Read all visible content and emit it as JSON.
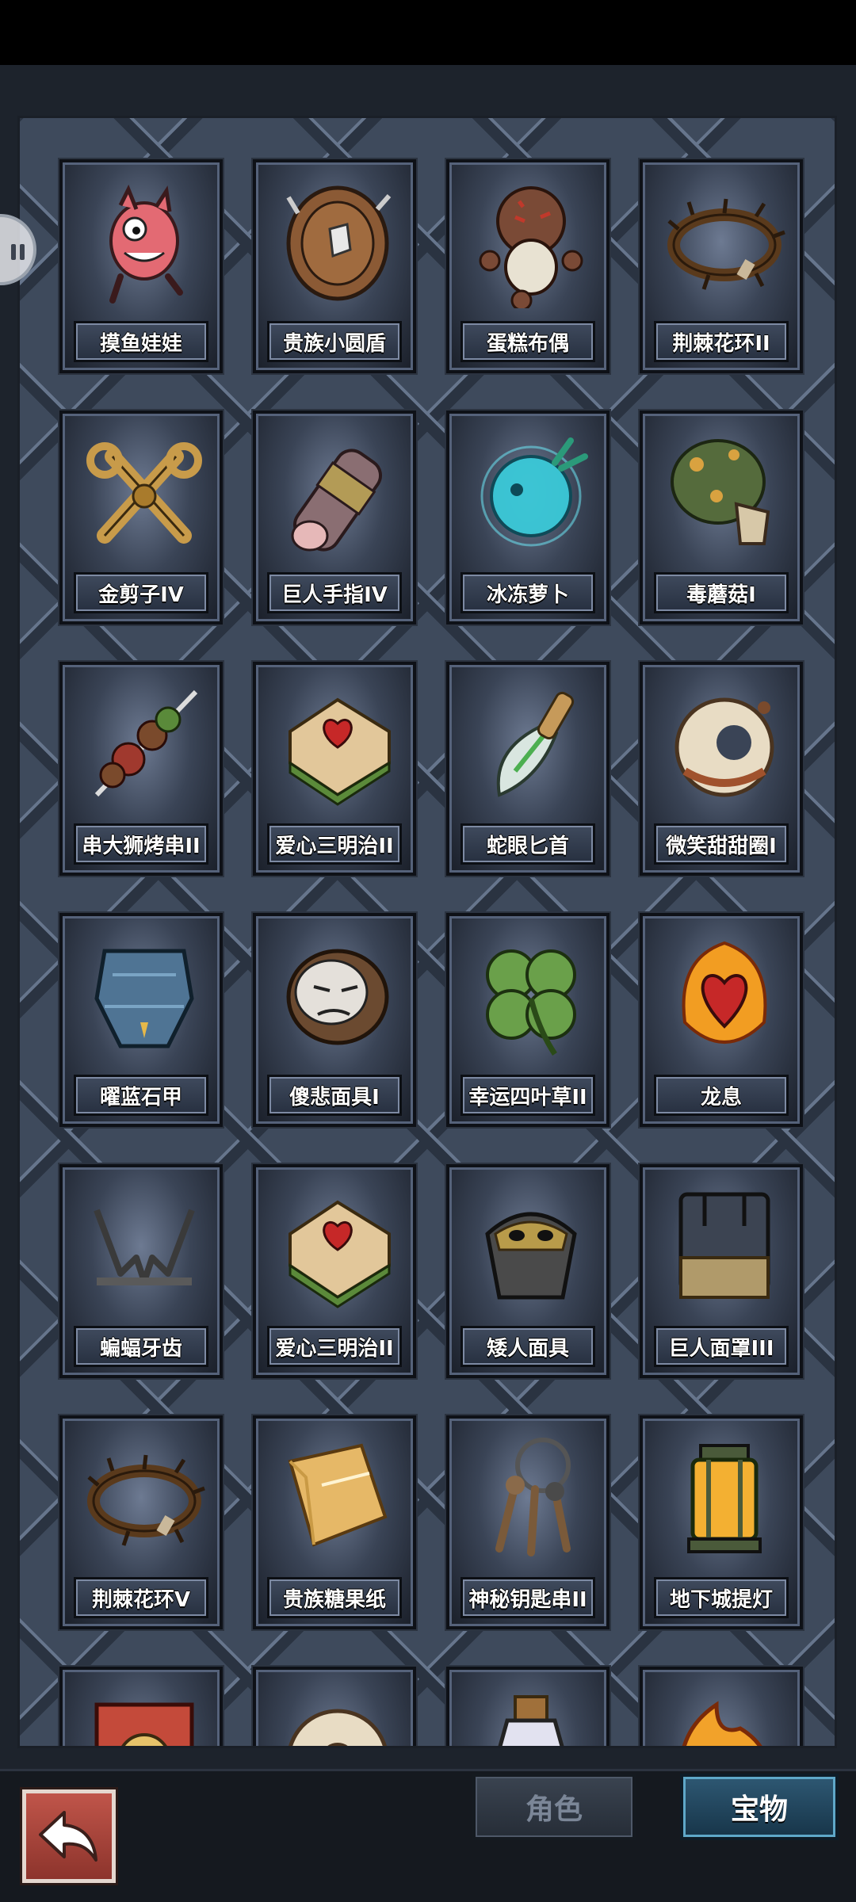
{
  "inventory": {
    "items": [
      {
        "name": "摸鱼娃娃",
        "icon": "pink-fish-doll-icon"
      },
      {
        "name": "贵族小圆盾",
        "icon": "wooden-round-shield-icon"
      },
      {
        "name": "蛋糕布偶",
        "icon": "cake-voodoo-doll-icon"
      },
      {
        "name": "荆棘花环II",
        "icon": "thorn-wreath-icon"
      },
      {
        "name": "金剪子IV",
        "icon": "golden-scissors-icon"
      },
      {
        "name": "巨人手指IV",
        "icon": "giant-finger-icon"
      },
      {
        "name": "冰冻萝卜",
        "icon": "frozen-turnip-icon"
      },
      {
        "name": "毒蘑菇I",
        "icon": "poison-mushroom-icon"
      },
      {
        "name": "串大狮烤串II",
        "icon": "meat-skewer-icon"
      },
      {
        "name": "爱心三明治II",
        "icon": "heart-sandwich-icon"
      },
      {
        "name": "蛇眼匕首",
        "icon": "green-dagger-icon"
      },
      {
        "name": "微笑甜甜圈I",
        "icon": "smile-donut-icon"
      },
      {
        "name": "曜蓝石甲",
        "icon": "blue-stone-armor-icon"
      },
      {
        "name": "傻悲面具I",
        "icon": "sad-mask-icon"
      },
      {
        "name": "幸运四叶草II",
        "icon": "four-leaf-clover-icon"
      },
      {
        "name": "龙息",
        "icon": "burning-heart-icon"
      },
      {
        "name": "蝙蝠牙齿",
        "icon": "bat-teeth-icon"
      },
      {
        "name": "爱心三明治II",
        "icon": "heart-sandwich-icon"
      },
      {
        "name": "矮人面具",
        "icon": "dwarf-mask-icon"
      },
      {
        "name": "巨人面罩III",
        "icon": "giant-face-guard-icon"
      },
      {
        "name": "荆棘花环V",
        "icon": "thorn-wreath-icon"
      },
      {
        "name": "贵族糖果纸",
        "icon": "candy-wrapper-icon"
      },
      {
        "name": "神秘钥匙串II",
        "icon": "key-ring-icon"
      },
      {
        "name": "地下城提灯",
        "icon": "dungeon-lantern-icon"
      },
      {
        "name": "",
        "icon": "treasure-card-icon"
      },
      {
        "name": "",
        "icon": "donut-icon"
      },
      {
        "name": "",
        "icon": "potion-bottle-icon"
      },
      {
        "name": "",
        "icon": "fire-spirit-icon"
      }
    ]
  },
  "tabs": {
    "character": "角色",
    "treasure": "宝物",
    "active": "treasure"
  },
  "colors": {
    "board": "#3e4a5c",
    "active_tab": "#2e5873",
    "back_button": "#a9443a"
  }
}
